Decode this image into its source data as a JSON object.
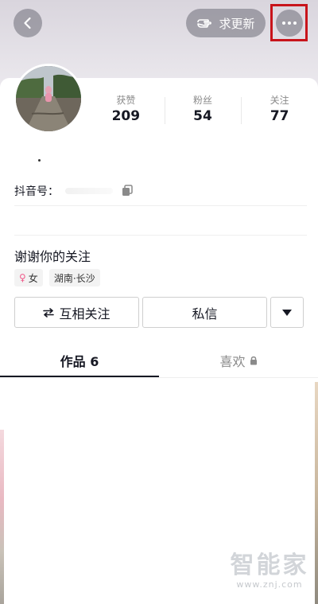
{
  "header": {
    "update_label": "求更新"
  },
  "profile": {
    "stats": [
      {
        "label": "获赞",
        "value": "209"
      },
      {
        "label": "粉丝",
        "value": "54"
      },
      {
        "label": "关注",
        "value": "77"
      }
    ],
    "douyin_id_label": "抖音号：",
    "bio": "谢谢你的关注",
    "tags": {
      "gender": "女",
      "location": "湖南·长沙"
    }
  },
  "actions": {
    "follow_label": "互相关注",
    "message_label": "私信"
  },
  "tabs": {
    "works_label": "作品 6",
    "likes_label": "喜欢"
  },
  "watermark": {
    "text": "智能家",
    "url": "www.znj.com"
  },
  "colors": {
    "highlight": "#c8141b",
    "gender_pink": "#f05b8b"
  },
  "icons": [
    "back-arrow-icon",
    "pointing-hand-icon",
    "more-dots-icon",
    "copy-icon",
    "swap-arrows-icon",
    "caret-down-icon",
    "lock-icon",
    "female-icon"
  ]
}
